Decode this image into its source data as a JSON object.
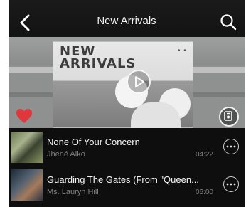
{
  "header": {
    "title": "New Arrivals",
    "back_icon": "chevron-left-icon",
    "search_icon": "search-icon"
  },
  "banner": {
    "art_line1": "NEW",
    "art_line2": "ARRIVALS",
    "art_dots": "• •",
    "play_icon": "play-icon",
    "like_icon": "heart-icon",
    "queue_icon": "playlist-icon"
  },
  "tracks": [
    {
      "title": "None Of Your Concern",
      "artist": "Jhené Aiko",
      "duration": "04:22",
      "more_icon": "more-icon"
    },
    {
      "title": "Guarding The Gates (From \"Queen...",
      "artist": "Ms. Lauryn Hill",
      "duration": "06:00",
      "more_icon": "more-icon"
    }
  ],
  "colors": {
    "background": "#0e0e0e",
    "heart": "#e0373e",
    "title_text": "#f2f2f2",
    "secondary_text": "#7f7f7f"
  }
}
